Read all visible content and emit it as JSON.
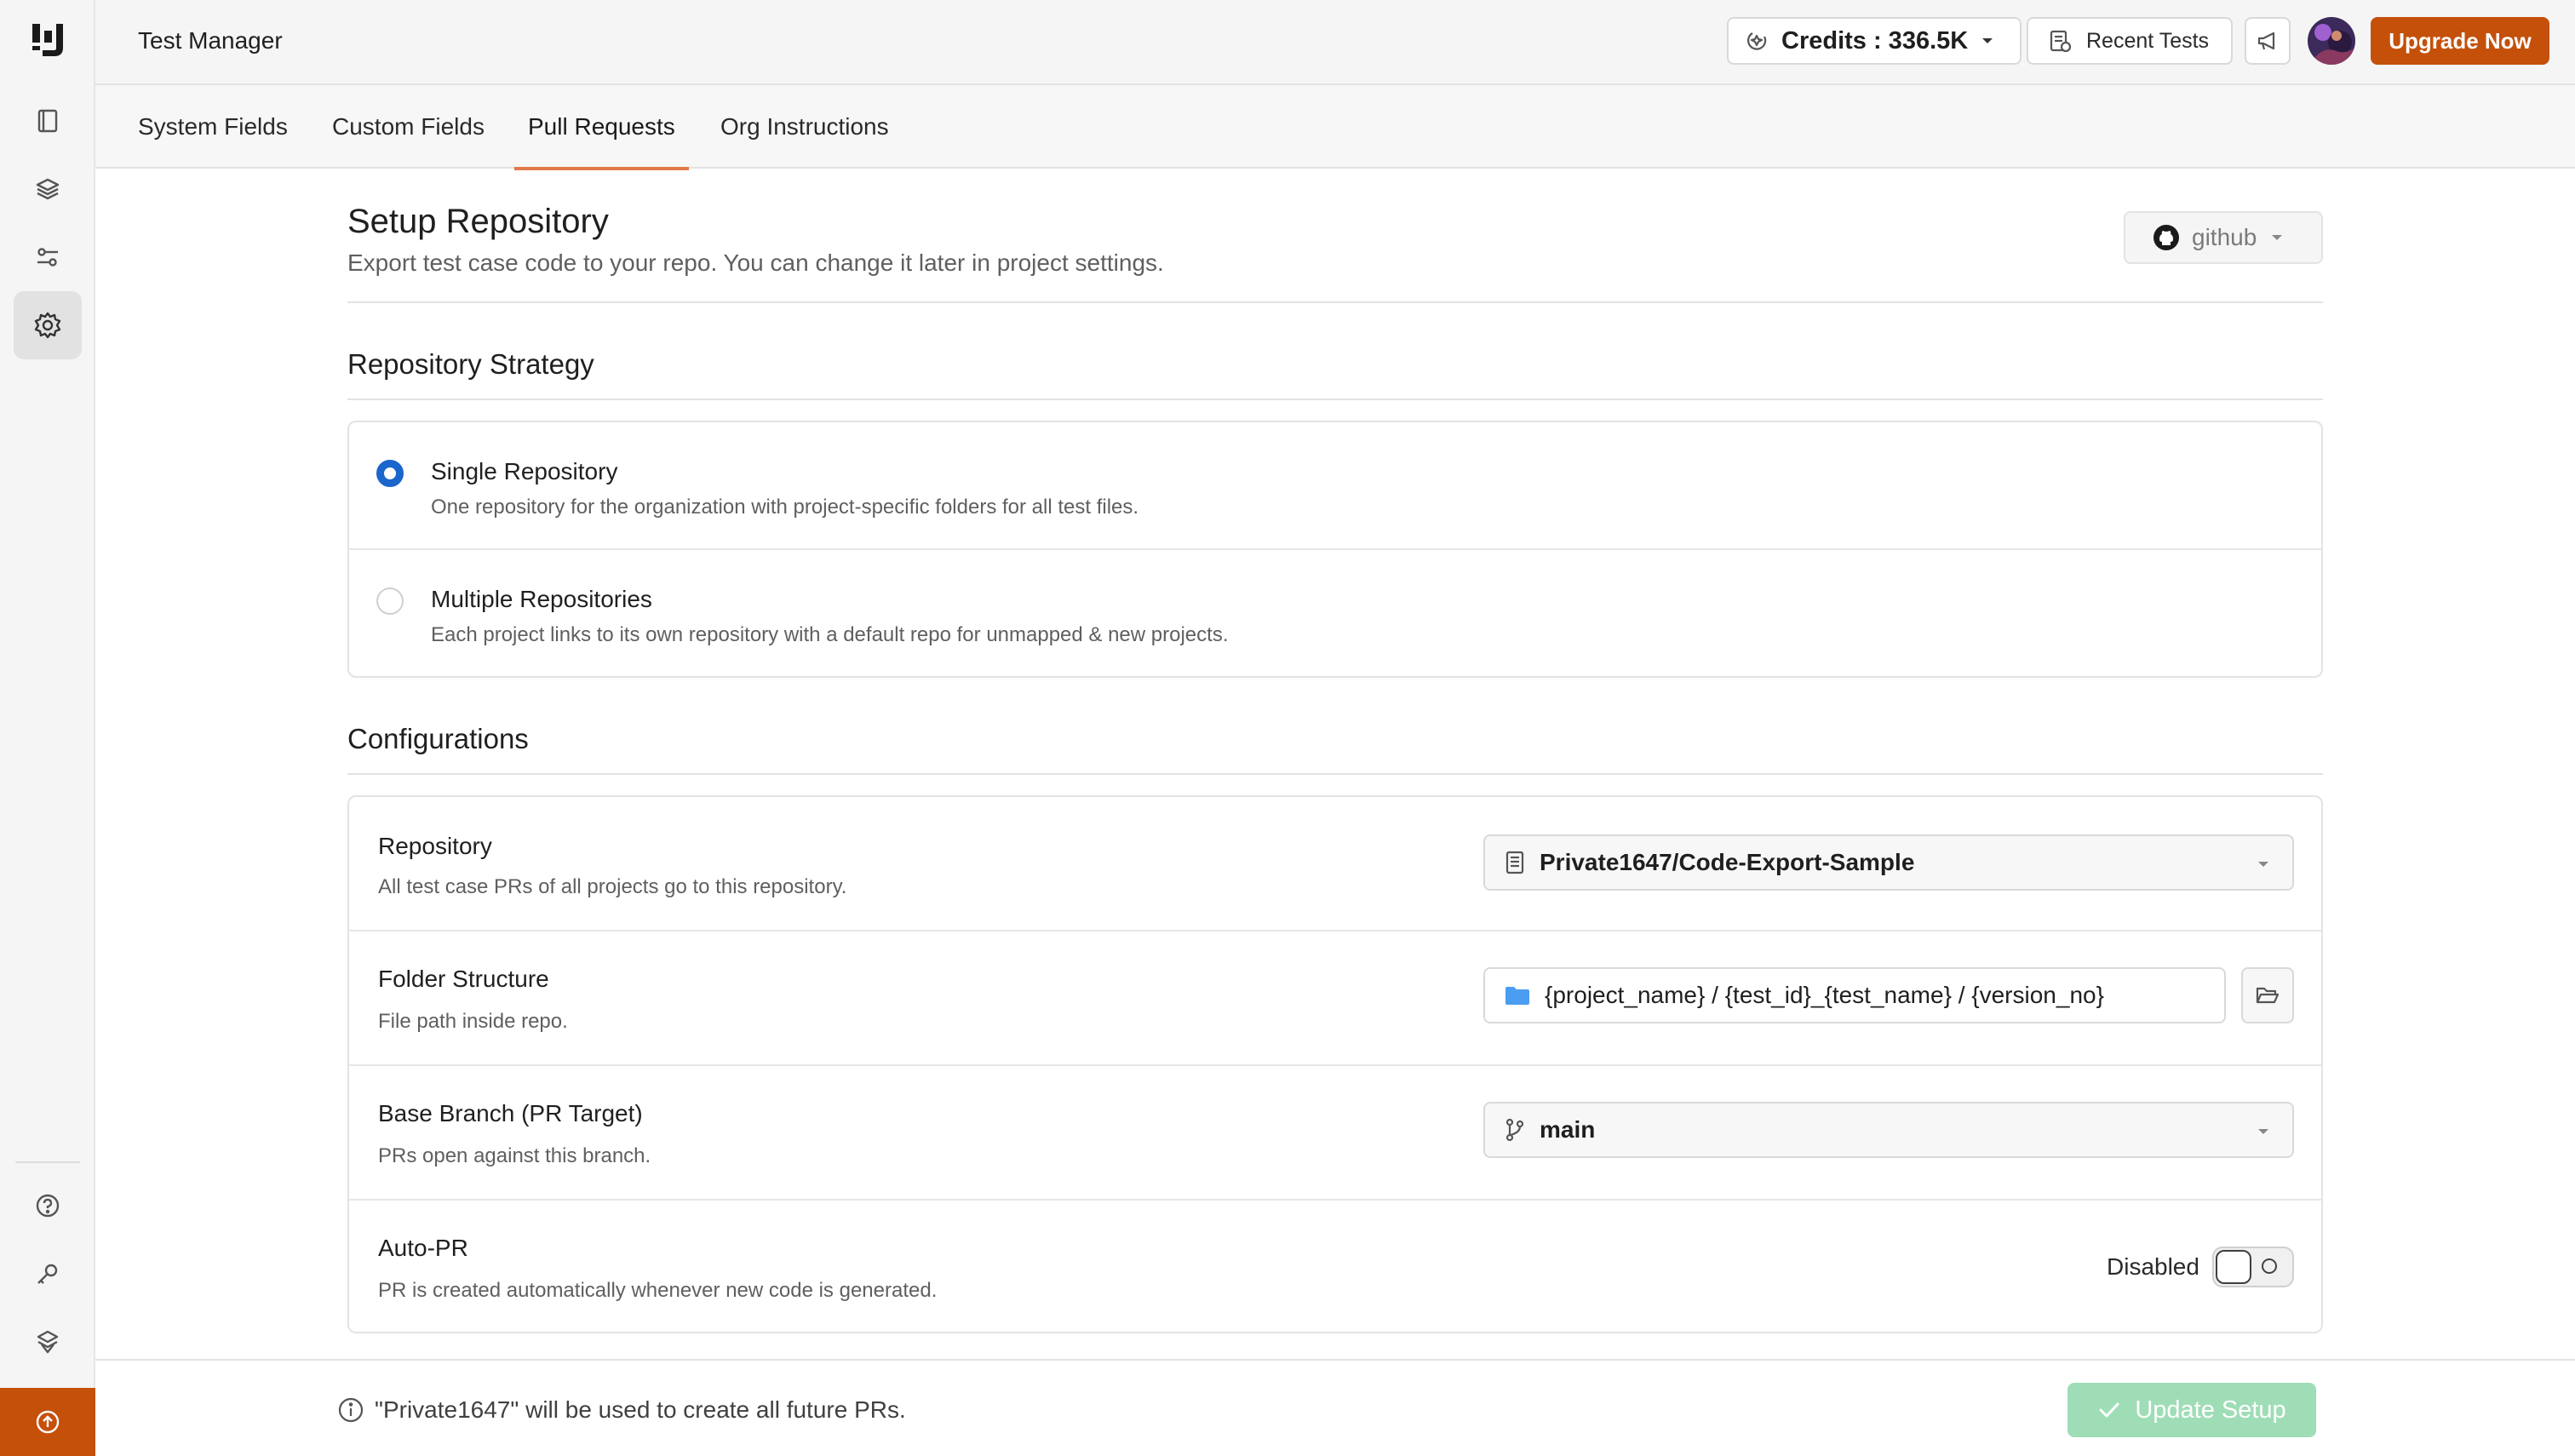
{
  "app": {
    "title": "Test Manager"
  },
  "header": {
    "credits_label": "Credits : 336.5K",
    "recent_tests_label": "Recent Tests",
    "upgrade_label": "Upgrade Now"
  },
  "tabs": [
    {
      "label": "System Fields",
      "active": false
    },
    {
      "label": "Custom Fields",
      "active": false
    },
    {
      "label": "Pull Requests",
      "active": true
    },
    {
      "label": "Org Instructions",
      "active": false
    }
  ],
  "setup": {
    "title": "Setup Repository",
    "subtitle": "Export test case code to your repo. You can change it later in project settings.",
    "provider": "github"
  },
  "strategy": {
    "title": "Repository Strategy",
    "options": [
      {
        "title": "Single Repository",
        "description": "One repository for the organization with project-specific folders for all test files.",
        "selected": true
      },
      {
        "title": "Multiple Repositories",
        "description": "Each project links to its own repository with a default repo for unmapped & new projects.",
        "selected": false
      }
    ]
  },
  "configurations": {
    "title": "Configurations",
    "repository": {
      "title": "Repository",
      "description": "All test case PRs of all projects go to this repository.",
      "value": "Private1647/Code-Export-Sample"
    },
    "folder": {
      "title": "Folder Structure",
      "description": "File path inside repo.",
      "value": "{project_name} / {test_id}_{test_name} / {version_no}"
    },
    "branch": {
      "title": "Base Branch (PR Target)",
      "description": "PRs open against this branch.",
      "value": "main"
    },
    "auto_pr": {
      "title": "Auto-PR",
      "description": "PR is created automatically whenever new code is generated.",
      "status": "Disabled",
      "enabled": false
    }
  },
  "footer": {
    "info": "\"Private1647\" will be used to create all future PRs.",
    "update_label": "Update Setup"
  },
  "colors": {
    "brand": "#c4500a",
    "radio": "#1a66cc",
    "tab_underline": "#e07a4a",
    "update_disabled": "#9fddb6"
  }
}
